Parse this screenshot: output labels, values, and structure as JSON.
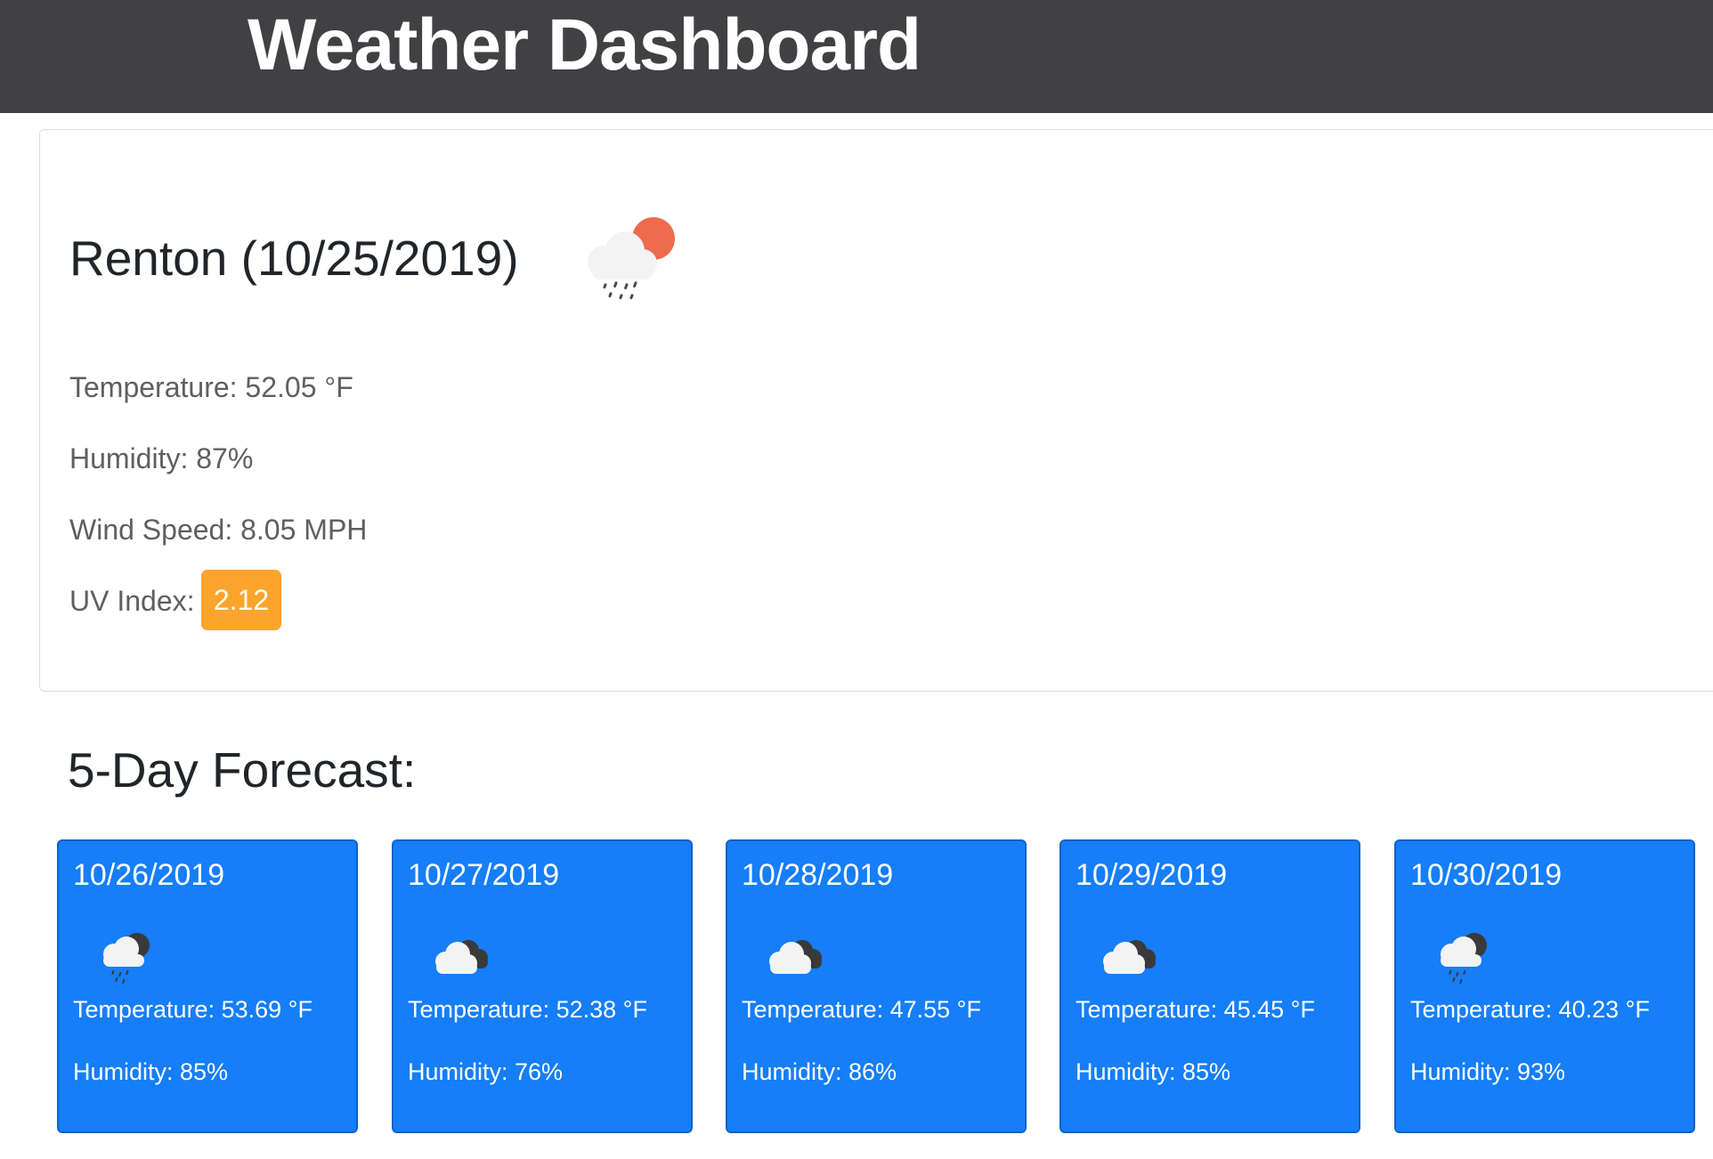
{
  "header": {
    "title": "Weather Dashboard"
  },
  "current": {
    "city_title": "Renton (10/25/2019)",
    "icon": "rain-cloud-sun-icon",
    "temperature": {
      "label": "Temperature:",
      "value": "52.05",
      "unit": "°F"
    },
    "humidity": {
      "label": "Humidity:",
      "value": "87%"
    },
    "wind": {
      "label": "Wind Speed:",
      "value": "8.05",
      "unit": "MPH"
    },
    "uv": {
      "label": "UV Index:",
      "value": "2.12",
      "color": "#fda42c"
    }
  },
  "forecast": {
    "title": "5-Day Forecast:",
    "card_color": "#157ef8",
    "days": [
      {
        "date": "10/26/2019",
        "icon": "rain-cloud-icon",
        "temperature": "Temperature: 53.69 °F",
        "humidity": "Humidity: 85%"
      },
      {
        "date": "10/27/2019",
        "icon": "cloudy-icon",
        "temperature": "Temperature: 52.38 °F",
        "humidity": "Humidity: 76%"
      },
      {
        "date": "10/28/2019",
        "icon": "cloudy-icon",
        "temperature": "Temperature: 47.55 °F",
        "humidity": "Humidity: 86%"
      },
      {
        "date": "10/29/2019",
        "icon": "cloudy-icon",
        "temperature": "Temperature: 45.45 °F",
        "humidity": "Humidity: 85%"
      },
      {
        "date": "10/30/2019",
        "icon": "rain-cloud-icon",
        "temperature": "Temperature: 40.23 °F",
        "humidity": "Humidity: 93%"
      }
    ]
  },
  "colors": {
    "header_bg": "#414042",
    "uv_badge": "#fda42c",
    "card_blue": "#157ef8"
  }
}
